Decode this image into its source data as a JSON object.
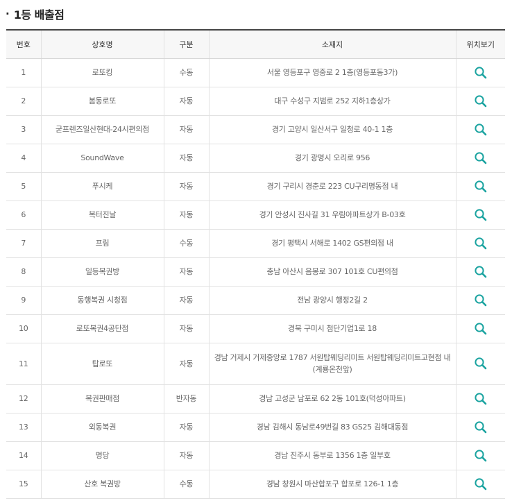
{
  "section": {
    "bullet": "·",
    "title": "1등 배출점"
  },
  "table": {
    "columns": [
      "번호",
      "상호명",
      "구분",
      "소재지",
      "위치보기"
    ],
    "rows": [
      {
        "no": "1",
        "name": "로또킹",
        "type": "수동",
        "address": "서울 영등포구 영중로 2 1층(영등포동3가)"
      },
      {
        "no": "2",
        "name": "봄동로또",
        "type": "자동",
        "address": "대구 수성구 지범로 252 지하1층상가"
      },
      {
        "no": "3",
        "name": "굳프렌즈일산현대-24시편의점",
        "type": "자동",
        "address": "경기 고양시 일산서구 일청로 40-1 1층"
      },
      {
        "no": "4",
        "name": "SoundWave",
        "type": "자동",
        "address": "경기 광명시 오리로 956"
      },
      {
        "no": "5",
        "name": "푸시케",
        "type": "자동",
        "address": "경기 구리시 경춘로 223 CU구리명동점 내"
      },
      {
        "no": "6",
        "name": "복터진날",
        "type": "자동",
        "address": "경기 안성시 진사길 31 우림아파트상가 B-03호"
      },
      {
        "no": "7",
        "name": "프림",
        "type": "수동",
        "address": "경기 평택시 서해로 1402 GS편의점 내"
      },
      {
        "no": "8",
        "name": "일등복권방",
        "type": "자동",
        "address": "충남 아산시 음봉로 307 101호 CU편의점"
      },
      {
        "no": "9",
        "name": "동행복권 시청점",
        "type": "자동",
        "address": "전남 광양시 행정2길 2"
      },
      {
        "no": "10",
        "name": "로또복권4공단점",
        "type": "자동",
        "address": "경북 구미시 첨단기업1로 18"
      },
      {
        "no": "11",
        "name": "탑로또",
        "type": "자동",
        "address": "경남 거제시 거제중앙로 1787 서원탑웨딩리미트 서원탑웨딩리미트고현점 내 (계룡온천앞)"
      },
      {
        "no": "12",
        "name": "복권판매점",
        "type": "반자동",
        "address": "경남 고성군 남포로 62 2동 101호(덕성아파트)"
      },
      {
        "no": "13",
        "name": "외동복권",
        "type": "자동",
        "address": "경남 김해시 동남로49번길 83 GS25 김해대동점"
      },
      {
        "no": "14",
        "name": "명당",
        "type": "자동",
        "address": "경남 진주시 동부로 1356 1층 일부호"
      },
      {
        "no": "15",
        "name": "산호 복권방",
        "type": "수동",
        "address": "경남 창원시 마산합포구 합포로 126-1 1층"
      }
    ]
  },
  "icons": {
    "location": "search-icon"
  },
  "colors": {
    "icon_accent": "#1aa3a0",
    "header_border": "#444444",
    "header_bg": "#f7f7f7"
  }
}
